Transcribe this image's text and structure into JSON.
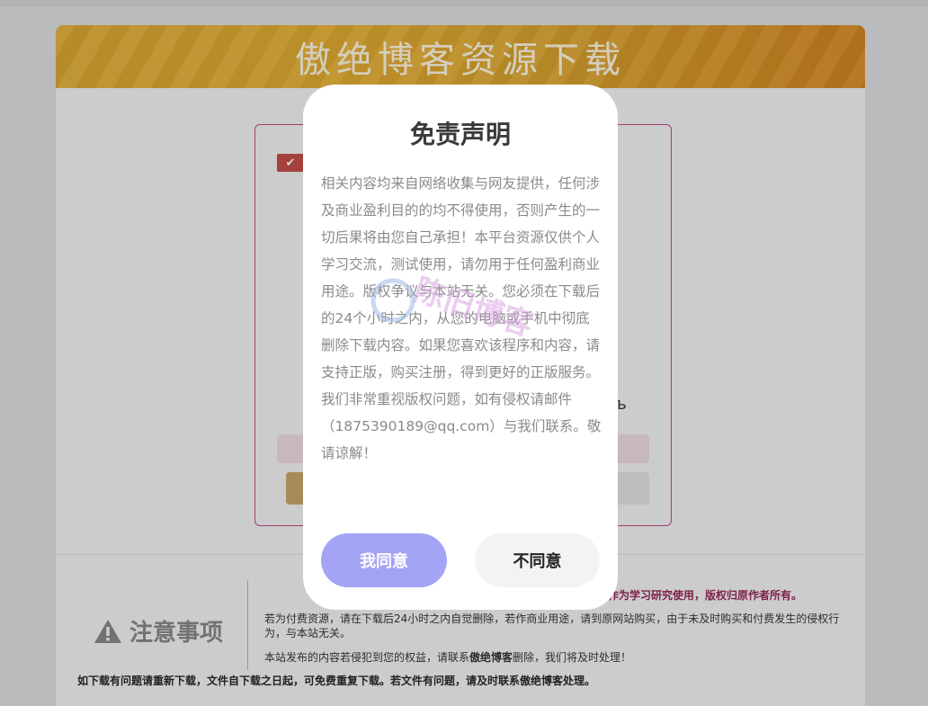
{
  "page": {
    "banner_title": "傲绝博客资源下载",
    "download_glyph": "ъ"
  },
  "notice": {
    "title": "注意事项",
    "highlight": "作为学习研究使用，版权归原作者所有。",
    "p1": "若为付费资源，请在下载后24小时之内自觉删除，若作商业用途，请到原网站购买，由于未及时购买和付费发生的侵权行为，与本站无关。",
    "p2_prefix": "本站发布的内容若侵犯到您的权益，请联系",
    "p2_name": "傲绝博客",
    "p2_suffix": "删除，我们将及时处理！",
    "footer": "如下载有问题请重新下载，文件自下载之日起，可免费重复下载。若文件有问题，请及时联系傲绝博客处理。"
  },
  "modal": {
    "title": "免责声明",
    "body": "相关内容均来自网络收集与网友提供，任何涉及商业盈利目的的均不得使用，否则产生的一切后果将由您自己承担！本平台资源仅供个人学习交流，测试使用，请勿用于任何盈利商业用途。版权争议与本站无关。您必须在下载后的24个小时之内，从您的电脑或手机中彻底删除下载内容。如果您喜欢该程序和内容，请支持正版，购买注册，得到更好的正版服务。我们非常重视版权问题，如有侵权请邮件（1875390189@qq.com）与我们联系。敬请谅解！",
    "agree_label": "我同意",
    "disagree_label": "不同意",
    "watermark_text": "陈旧博客"
  },
  "colors": {
    "agree_button": "#a3a4f5",
    "box_border": "#b0407a",
    "highlight_text": "#8b1f4c"
  }
}
